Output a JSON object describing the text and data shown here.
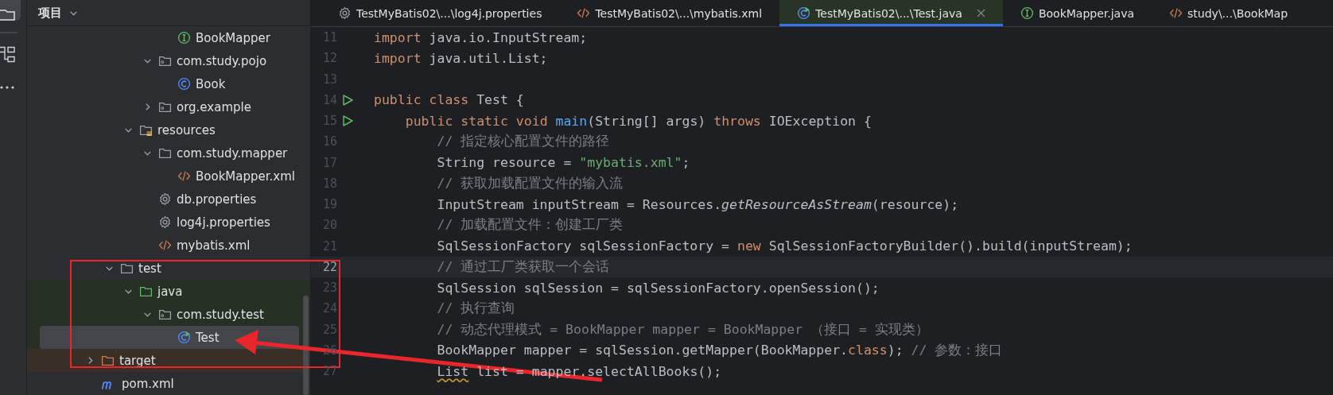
{
  "project_panel": {
    "title": "项目",
    "tree": [
      {
        "children": [
          {
            "children": [
              {
                "children": [
                  {
                    "children": [
                      {
                        "label": "BookMapper",
                        "kind": "interface",
                        "selected": false
                      }
                    ]
                  },
                  {
                    "label": "com.study.pojo",
                    "kind": "package",
                    "expanded": true,
                    "selected": false,
                    "children": [
                      {
                        "label": "Book",
                        "kind": "class",
                        "selected": false
                      }
                    ]
                  },
                  {
                    "label": "org.example",
                    "kind": "package",
                    "expanded": false,
                    "selected": false
                  }
                ]
              },
              {
                "label": "resources",
                "kind": "resources",
                "expanded": true,
                "selected": false,
                "children": [
                  {
                    "label": "com.study.mapper",
                    "kind": "folder",
                    "expanded": true,
                    "selected": false,
                    "children": [
                      {
                        "label": "BookMapper.xml",
                        "kind": "xml",
                        "selected": false
                      }
                    ]
                  },
                  {
                    "label": "db.properties",
                    "kind": "properties",
                    "selected": false
                  },
                  {
                    "label": "log4j.properties",
                    "kind": "properties",
                    "selected": false
                  },
                  {
                    "label": "mybatis.xml",
                    "kind": "xml",
                    "selected": false
                  }
                ]
              }
            ]
          },
          {
            "label": "test",
            "kind": "folder",
            "expanded": true,
            "selected": false,
            "children": [
              {
                "label": "java",
                "kind": "test_source",
                "expanded": true,
                "selected": false,
                "children": [
                  {
                    "label": "com.study.test",
                    "kind": "package",
                    "expanded": true,
                    "selected": false,
                    "children": [
                      {
                        "label": "Test",
                        "kind": "test_class",
                        "selected": true
                      }
                    ]
                  }
                ]
              }
            ]
          }
        ]
      },
      {
        "label": "target",
        "kind": "excluded",
        "expanded": false,
        "selected": false
      },
      {
        "label": "pom.xml",
        "kind": "maven",
        "selected": false
      }
    ]
  },
  "tabs": [
    {
      "label": "TestMyBatis02\\...\\log4j.properties",
      "kind": "properties",
      "selected": false
    },
    {
      "label": "TestMyBatis02\\...\\mybatis.xml",
      "kind": "xml",
      "selected": false
    },
    {
      "label": "TestMyBatis02\\...\\Test.java",
      "kind": "test_class",
      "selected": true
    },
    {
      "label": "BookMapper.java",
      "kind": "interface",
      "selected": false
    },
    {
      "label": "study\\...\\BookMap",
      "kind": "xml",
      "selected": false
    }
  ],
  "editor": {
    "lines": [
      {
        "number": "11",
        "run": false,
        "current": false,
        "tokens": [
          {
            "text": "import",
            "kind": "keyword"
          },
          {
            "text": " java.io.InputStream;",
            "kind": "plain"
          }
        ]
      },
      {
        "number": "12",
        "run": false,
        "current": false,
        "tokens": [
          {
            "text": "import",
            "kind": "keyword"
          },
          {
            "text": " java.util.List;",
            "kind": "plain"
          }
        ]
      },
      {
        "number": "13",
        "run": false,
        "current": false
      },
      {
        "number": "14",
        "run": true,
        "current": false,
        "tokens": [
          {
            "text": "public class",
            "kind": "keyword"
          },
          {
            "text": " Test {",
            "kind": "plain"
          }
        ]
      },
      {
        "number": "15",
        "run": true,
        "current": false,
        "tokens": [
          {
            "text": "    public static void ",
            "kind": "keyword"
          },
          {
            "text": "main",
            "kind": "method"
          },
          {
            "text": "(String[] args) ",
            "kind": "plain"
          },
          {
            "text": "throws",
            "kind": "keyword"
          },
          {
            "text": " IOException {",
            "kind": "plain"
          }
        ]
      },
      {
        "number": "16",
        "run": false,
        "current": false,
        "tokens": [
          {
            "text": "        // 指定核心配置文件的路径",
            "kind": "comment"
          }
        ]
      },
      {
        "number": "17",
        "run": false,
        "current": false,
        "tokens": [
          {
            "text": "        String resource = ",
            "kind": "plain"
          },
          {
            "text": "\"mybatis.xml\"",
            "kind": "string"
          },
          {
            "text": ";",
            "kind": "plain"
          }
        ]
      },
      {
        "number": "18",
        "run": false,
        "current": false,
        "tokens": [
          {
            "text": "        // 获取加载配置文件的输入流",
            "kind": "comment"
          }
        ]
      },
      {
        "number": "19",
        "run": false,
        "current": false,
        "tokens": [
          {
            "text": "        InputStream inputStream = Resources.",
            "kind": "plain"
          },
          {
            "text": "getResourceAsStream",
            "kind": "static"
          },
          {
            "text": "(resource);",
            "kind": "plain"
          }
        ]
      },
      {
        "number": "20",
        "run": false,
        "current": false,
        "tokens": [
          {
            "text": "        // 加载配置文件：创建工厂类",
            "kind": "comment"
          }
        ]
      },
      {
        "number": "21",
        "run": false,
        "current": false,
        "tokens": [
          {
            "text": "        SqlSessionFactory sqlSessionFactory = ",
            "kind": "plain"
          },
          {
            "text": "new",
            "kind": "keyword"
          },
          {
            "text": " SqlSessionFactoryBuilder().build(inputStream);",
            "kind": "plain"
          }
        ]
      },
      {
        "number": "22",
        "run": false,
        "current": true,
        "tokens": [
          {
            "text": "        // 通过工厂类获取一个会话",
            "kind": "comment"
          }
        ]
      },
      {
        "number": "23",
        "run": false,
        "current": false,
        "tokens": [
          {
            "text": "        SqlSession sqlSession = sqlSessionFactory.openSession();",
            "kind": "plain"
          }
        ]
      },
      {
        "number": "24",
        "run": false,
        "current": false,
        "tokens": [
          {
            "text": "        // 执行查询",
            "kind": "comment"
          }
        ]
      },
      {
        "number": "25",
        "run": false,
        "current": false,
        "tokens": [
          {
            "text": "        // 动态代理模式 = BookMapper mapper = BookMapper （接口 = 实现类）",
            "kind": "comment"
          }
        ]
      },
      {
        "number": "26",
        "run": false,
        "current": false,
        "tokens": [
          {
            "text": "        BookMapper mapper = sqlSession.getMapper(BookMapper.",
            "kind": "plain"
          },
          {
            "text": "class",
            "kind": "keyword"
          },
          {
            "text": "); ",
            "kind": "plain"
          },
          {
            "text": "// 参数：接口",
            "kind": "comment"
          }
        ]
      },
      {
        "number": "27",
        "run": false,
        "current": false,
        "tokens": [
          {
            "text": "        List",
            "kind": "warning"
          },
          {
            "text": " list = mapper.selectAllBooks();",
            "kind": "plain"
          }
        ]
      }
    ]
  }
}
